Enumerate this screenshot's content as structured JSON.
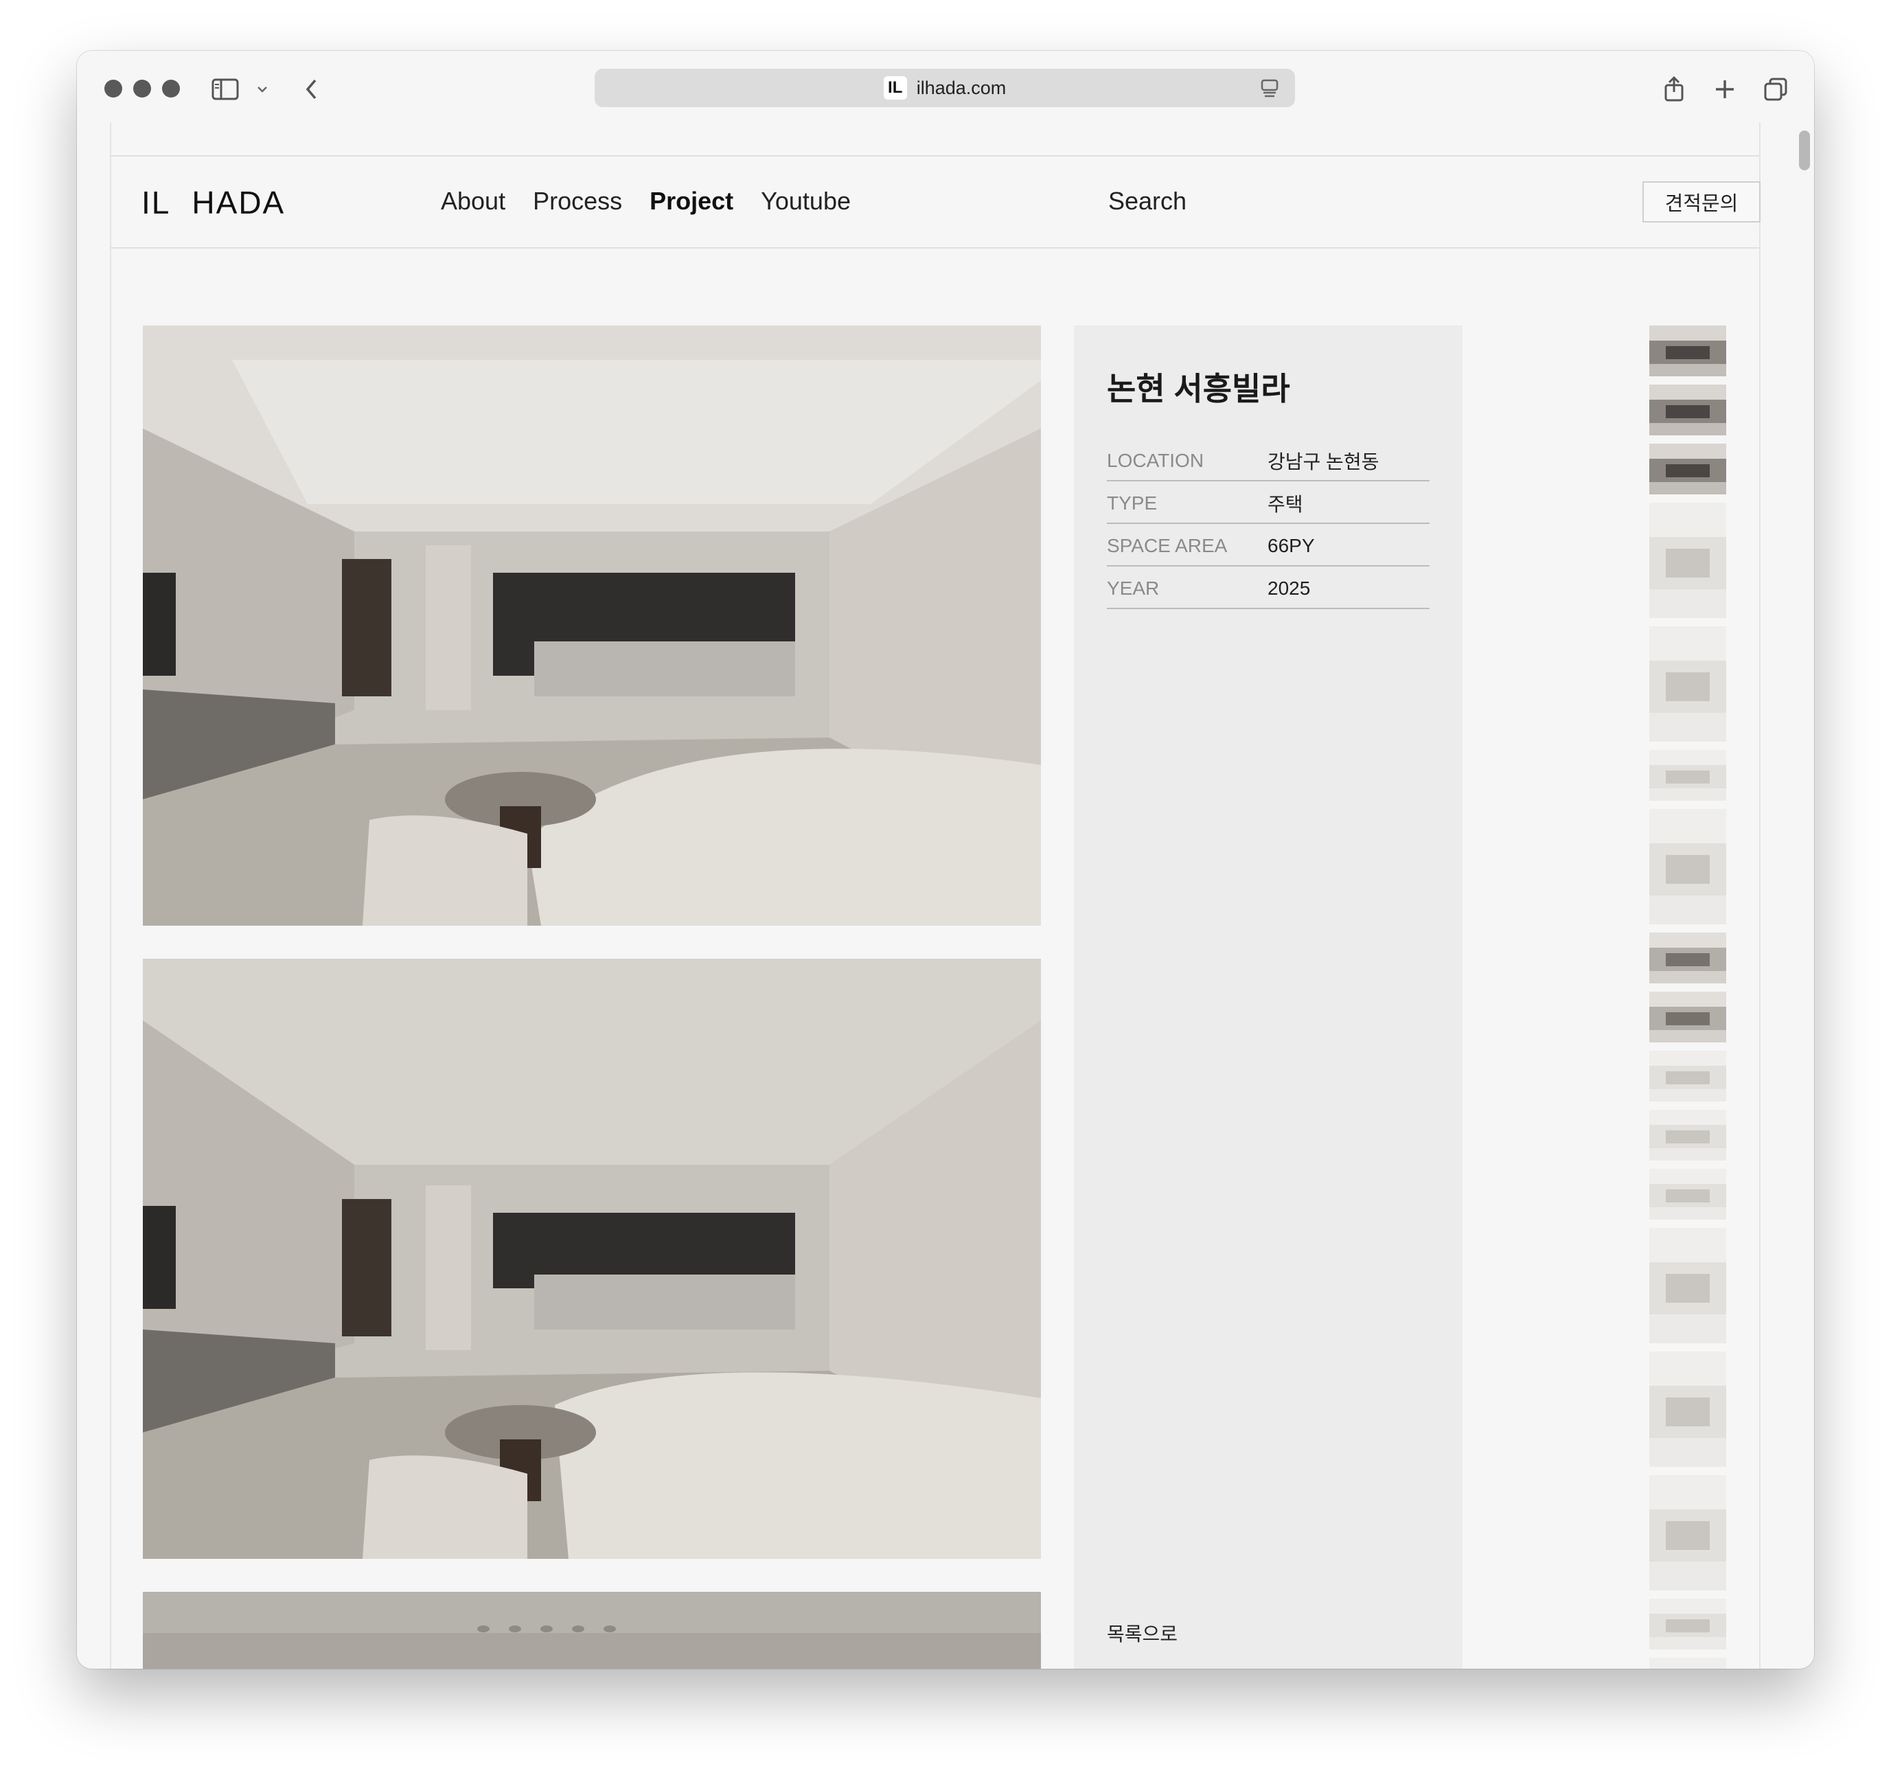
{
  "browser": {
    "url": "ilhada.com",
    "favicon_text": "IL"
  },
  "site": {
    "logo": "IL HADA",
    "nav": [
      {
        "label": "About",
        "active": false
      },
      {
        "label": "Process",
        "active": false
      },
      {
        "label": "Project",
        "active": true
      },
      {
        "label": "Youtube",
        "active": false
      }
    ],
    "search_label": "Search",
    "quote_button": "견적문의"
  },
  "project": {
    "title": "논현 서흥빌라",
    "details": [
      {
        "key": "LOCATION",
        "value": "강남구 논현동"
      },
      {
        "key": "TYPE",
        "value": "주택"
      },
      {
        "key": "SPACE AREA",
        "value": "66PY"
      },
      {
        "key": "YEAR",
        "value": "2025"
      }
    ],
    "back_label": "목록으로"
  },
  "thumbnails": [
    {
      "tone": "dark",
      "shape": "short"
    },
    {
      "tone": "dark",
      "shape": "short"
    },
    {
      "tone": "dark",
      "shape": "short"
    },
    {
      "tone": "light",
      "shape": "tall"
    },
    {
      "tone": "light",
      "shape": "tall"
    },
    {
      "tone": "light",
      "shape": "short"
    },
    {
      "tone": "light",
      "shape": "tall"
    },
    {
      "tone": "mid",
      "shape": "short"
    },
    {
      "tone": "mid",
      "shape": "short"
    },
    {
      "tone": "light",
      "shape": "short"
    },
    {
      "tone": "light",
      "shape": "short"
    },
    {
      "tone": "light",
      "shape": "short"
    },
    {
      "tone": "light",
      "shape": "tall"
    },
    {
      "tone": "light",
      "shape": "tall"
    },
    {
      "tone": "light",
      "shape": "tall"
    },
    {
      "tone": "light",
      "shape": "short"
    },
    {
      "tone": "light",
      "shape": "short"
    }
  ],
  "colors": {
    "page_bg": "#f6f6f6",
    "panel_bg": "#ececec",
    "text": "#1a1a1a",
    "muted": "#8a8a8a"
  }
}
